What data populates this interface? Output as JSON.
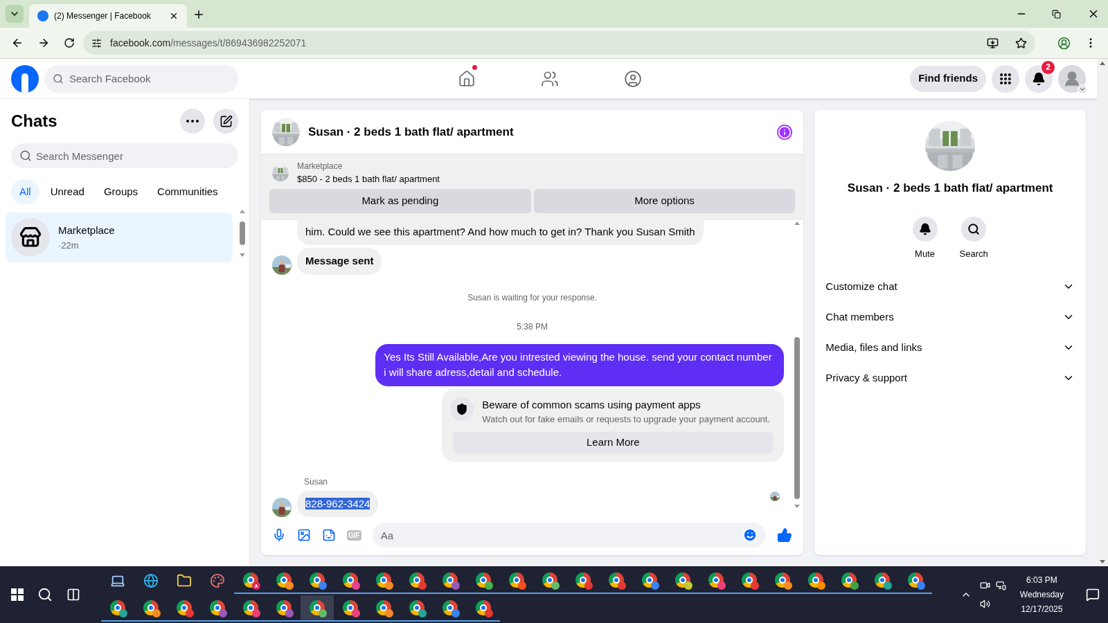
{
  "browser": {
    "tab_title": "(2) Messenger | Facebook",
    "url_host": "facebook.com",
    "url_path": "/messages/t/869436982252071"
  },
  "header": {
    "search_placeholder": "Search Facebook",
    "nav": [
      {
        "kind": "home",
        "selected": false,
        "dot": true
      },
      {
        "kind": "friends",
        "selected": false,
        "dot": false
      },
      {
        "kind": "groups",
        "selected": false,
        "dot": false
      }
    ],
    "find_friends": "Find friends",
    "notifications": "2"
  },
  "sidebar": {
    "title": "Chats",
    "search_placeholder": "Search Messenger",
    "filters": [
      {
        "label": "All",
        "selected": true
      },
      {
        "label": "Unread",
        "selected": false
      },
      {
        "label": "Groups",
        "selected": false
      },
      {
        "label": "Communities",
        "selected": false
      }
    ],
    "chats": [
      {
        "name": "Marketplace",
        "time": "·22m",
        "selected": true
      }
    ]
  },
  "chat": {
    "title": "Susan · 2 beds 1 bath flat/ apartment",
    "listing_source": "Marketplace",
    "listing": "$850 - 2 beds 1 bath flat/ apartment",
    "actions": [
      "Mark as pending",
      "More options"
    ],
    "messages": [
      {
        "kind": "incoming",
        "text": "him. Could we see this apartment? And how much to get in? Thank you Susan Smith",
        "avatar": false,
        "bold": false,
        "highlighted": false
      },
      {
        "kind": "incoming",
        "text": "Message sent",
        "avatar": true,
        "bold": true,
        "highlighted": false
      },
      {
        "kind": "event",
        "text": "Susan is waiting for your response."
      },
      {
        "kind": "time",
        "text": "5:38 PM"
      },
      {
        "kind": "outgoing",
        "text": "Yes Its Still Available,Are you intrested viewing the house. send your contact number i will share adress,detail and schedule."
      },
      {
        "kind": "notice",
        "title": "Beware of common scams using payment apps",
        "text": "Watch out for fake emails or requests to upgrade your payment account.",
        "button": "Learn More"
      },
      {
        "kind": "sender",
        "text": "Susan"
      },
      {
        "kind": "incoming",
        "text": "828-962-3424",
        "avatar": true,
        "bold": false,
        "highlighted": true
      }
    ],
    "composer": {
      "placeholder": "Aa",
      "gif": "GIF"
    }
  },
  "details": {
    "name": "Susan · 2 beds 1 bath flat/ apartment",
    "actions": [
      {
        "kind": "mute",
        "label": "Mute"
      },
      {
        "kind": "search",
        "label": "Search"
      }
    ],
    "sections": [
      {
        "label": "Customize chat",
        "expanded": false
      },
      {
        "label": "Chat members",
        "expanded": false
      },
      {
        "label": "Media, files and links",
        "expanded": false
      },
      {
        "label": "Privacy & support",
        "expanded": false
      }
    ]
  },
  "taskbar": {
    "pinned": [
      {
        "kind": "laptop"
      },
      {
        "kind": "edge"
      },
      {
        "kind": "folder"
      },
      {
        "kind": "paint"
      }
    ],
    "row1": [
      {
        "color": "#e0245e",
        "badge": "A"
      },
      {
        "color": "#f28c28"
      },
      {
        "color": "#3b82f6"
      },
      {
        "color": "#e84393"
      },
      {
        "color": "#f28c28"
      },
      {
        "color": "#e53935"
      },
      {
        "color": "#9b59b6"
      },
      {
        "color": "#4caf50"
      },
      {
        "color": "#f4511e"
      },
      {
        "color": "#66bb6a"
      },
      {
        "color": "#e53935"
      },
      {
        "color": "#e53935"
      },
      {
        "color": "#3b82f6"
      },
      {
        "color": "#c0ca33"
      },
      {
        "color": "#ec407a"
      },
      {
        "color": "#e53935"
      },
      {
        "color": "#f28c28"
      },
      {
        "color": "#fb8c00"
      },
      {
        "color": "#43a047"
      },
      {
        "color": "#26a69a"
      },
      {
        "color": "#3b82f6"
      }
    ],
    "row2": [
      {
        "color": "#26a69a",
        "selected": false
      },
      {
        "color": "#f28c28",
        "selected": false
      },
      {
        "color": "#e53935",
        "selected": false
      },
      {
        "color": "#9b59b6",
        "selected": false
      },
      {
        "color": "#ec407a",
        "selected": false
      },
      {
        "color": "#9b59b6",
        "selected": false
      },
      {
        "color": "#66bb6a",
        "selected": true
      },
      {
        "color": "#ec407a",
        "selected": false
      },
      {
        "color": "#f28c28",
        "selected": false
      },
      {
        "color": "#26a69a",
        "selected": false
      },
      {
        "color": "#3b82f6",
        "selected": false
      },
      {
        "color": "#e53935",
        "selected": false
      }
    ],
    "time": "6:03 PM",
    "day": "Wednesday",
    "date": "12/17/2025"
  }
}
